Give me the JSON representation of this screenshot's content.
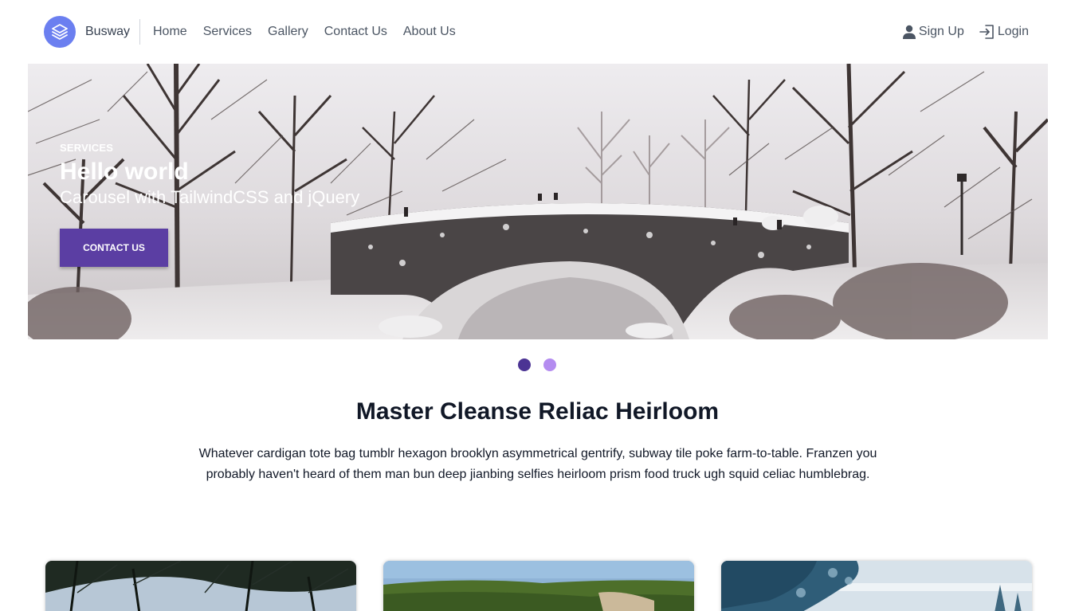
{
  "header": {
    "brand": "Busway",
    "nav": [
      "Home",
      "Services",
      "Gallery",
      "Contact Us",
      "About Us"
    ],
    "sign_up": "Sign Up",
    "login": "Login"
  },
  "hero": {
    "kicker": "SERVICES",
    "title": "Hello world",
    "subtitle": "Carousel with TailwindCSS and jQuery",
    "button": "CONTACT US",
    "active_slide": 1,
    "slide_count": 2
  },
  "section": {
    "title": "Master Cleanse Reliac Heirloom",
    "text": "Whatever cardigan tote bag tumblr hexagon brooklyn asymmetrical gentrify, subway tile poke farm-to-table. Franzen you probably haven't heard of them man bun deep jianbing selfies heirloom prism food truck ugh squid celiac humblebrag."
  },
  "colors": {
    "accent": "#5b3ea3",
    "dot_active": "#4c3494",
    "dot_inactive": "#b48cf0",
    "logo": "#6b7ff0"
  },
  "icons": {
    "logo": "layers-icon",
    "sign_up": "user-icon",
    "login": "login-icon"
  }
}
